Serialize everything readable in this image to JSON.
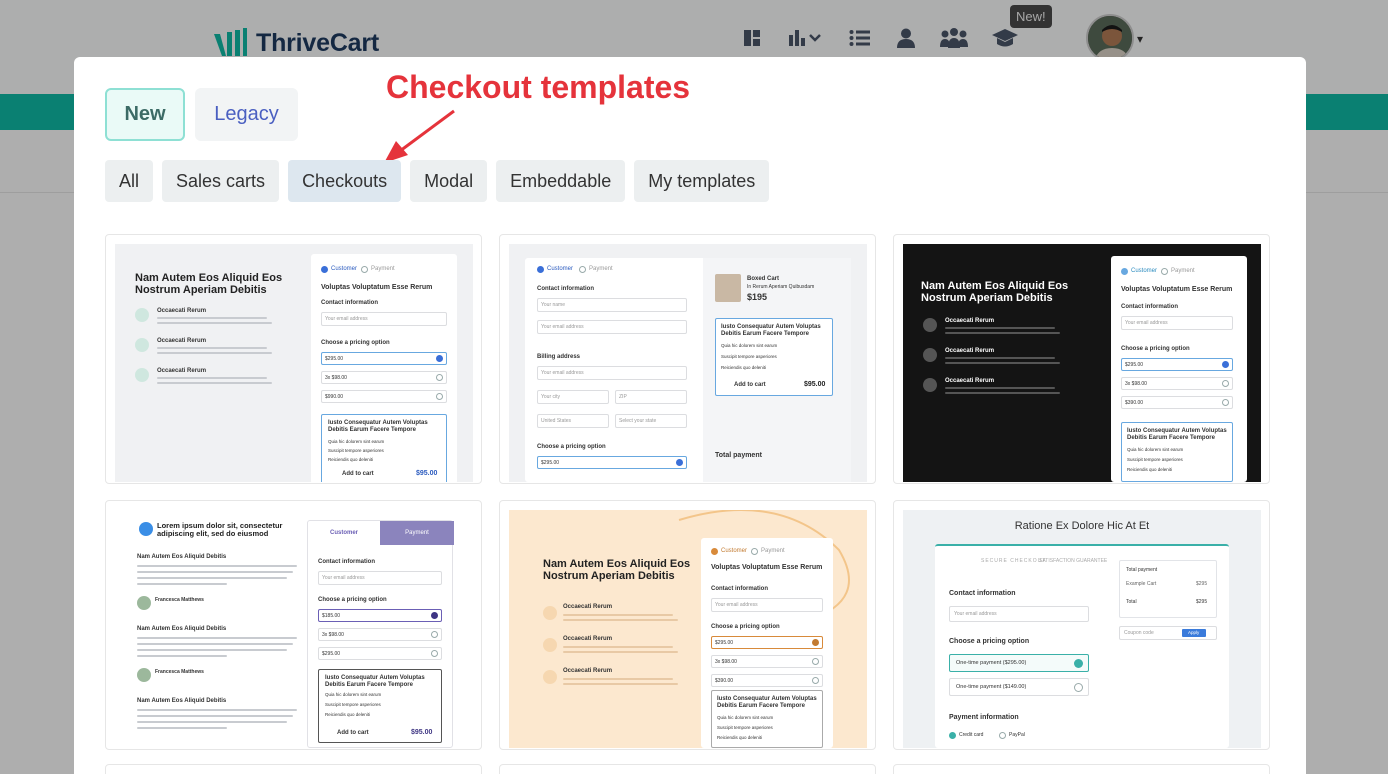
{
  "app": {
    "brand": "ThriveCart",
    "new_badge": "New!",
    "nav_icons": [
      "dashboard-icon",
      "analytics-icon",
      "list-icon",
      "user-icon",
      "team-icon",
      "graduation-cap-icon"
    ]
  },
  "modal": {
    "annotation": "Checkout templates",
    "toggle": {
      "new_label": "New",
      "legacy_label": "Legacy"
    },
    "filters": [
      {
        "label": "All"
      },
      {
        "label": "Sales carts"
      },
      {
        "label": "Checkouts"
      },
      {
        "label": "Modal"
      },
      {
        "label": "Embeddable"
      },
      {
        "label": "My templates"
      }
    ],
    "active_filter": "Checkouts"
  },
  "templates": [
    {
      "heading": "Nam Autem Eos Aliquid Eos Nostrum Aperiam Debitis",
      "steps": [
        "Customer",
        "Payment"
      ],
      "form_title": "Voluptas Voluptatum Esse Rerum",
      "contact": "Contact information",
      "email_placeholder": "Your email address",
      "pricing": "Choose a pricing option",
      "features": [
        "Occaecati Rerum",
        "Occaecati Rerum",
        "Occaecati Rerum"
      ],
      "bump_title": "Iusto Consequatur Autem Voluptas Debitis Earum Facere Tempore",
      "bump_items": [
        "Quia hic dolorem sint earum",
        "Suscipit tempore asperiores",
        "Reiciendis quo deleniti"
      ],
      "add_to_cart": "Add to cart",
      "price": "$95.00",
      "options": [
        "$295.00",
        "3x $98.00",
        "$990.00"
      ]
    },
    {
      "steps": [
        "Customer",
        "Payment"
      ],
      "contact": "Contact information",
      "name_placeholder": "Your name",
      "email_placeholder": "Your email address",
      "billing": "Billing address",
      "pricing": "Choose a pricing option",
      "product_title": "Boxed Cart",
      "product_sub": "In Rerum Aperiam Quibusdam",
      "product_price": "$195",
      "bump_title": "Iusto Consequatur Autem Voluptas Debitis Earum Facere Tempore",
      "bump_items": [
        "Quia hic dolorem sint earum",
        "Suscipit tempore asperiores",
        "Reiciendis quo deleniti"
      ],
      "add_to_cart": "Add to cart",
      "price": "$95.00",
      "total": "Total payment",
      "country": "United States",
      "state": "Select your state",
      "city": "Your city",
      "zip": "ZIP",
      "option": "$295.00"
    },
    {
      "heading": "Nam Autem Eos Aliquid Eos Nostrum Aperiam Debitis",
      "steps": [
        "Customer",
        "Payment"
      ],
      "form_title": "Voluptas Voluptatum Esse Rerum",
      "contact": "Contact information",
      "email_placeholder": "Your email address",
      "pricing": "Choose a pricing option",
      "features": [
        "Occaecati Rerum",
        "Occaecati Rerum",
        "Occaecati Rerum"
      ],
      "bump_title": "Iusto Consequatur Autem Voluptas Debitis Earum Facere Tempore",
      "bump_items": [
        "Quia hic dolorem sint earum",
        "Suscipit tempore asperiores",
        "Reiciendis quo deleniti"
      ],
      "options": [
        "$295.00",
        "3x $98.00",
        "$390.00"
      ]
    },
    {
      "heading": "Lorem ipsum dolor sit, consectetur adipiscing elit, sed do eiusmod",
      "tabs": [
        "Customer",
        "Payment"
      ],
      "contact": "Contact information",
      "email_placeholder": "Your email address",
      "pricing": "Choose a pricing option",
      "testimonials": [
        "Nam Autem Eos Aliquid Debitis",
        "Nam Autem Eos Aliquid Debitis",
        "Nam Autem Eos Aliquid Debitis"
      ],
      "author": "Francesca Matthews",
      "bump_title": "Iusto Consequatur Autem Voluptas Debitis Earum Facere Tempore",
      "bump_items": [
        "Quia hic dolorem sint earum",
        "Suscipit tempore asperiores",
        "Reiciendis quo deleniti"
      ],
      "add_to_cart": "Add to cart",
      "price": "$95.00",
      "options": [
        "$185.00",
        "3x $98.00",
        "$295.00"
      ]
    },
    {
      "heading": "Nam Autem Eos Aliquid Eos Nostrum Aperiam Debitis",
      "steps": [
        "Customer",
        "Payment"
      ],
      "form_title": "Voluptas Voluptatum Esse Rerum",
      "contact": "Contact information",
      "email_placeholder": "Your email address",
      "pricing": "Choose a pricing option",
      "features": [
        "Occaecati Rerum",
        "Occaecati Rerum",
        "Occaecati Rerum"
      ],
      "bump_title": "Iusto Consequatur Autem Voluptas Debitis Earum Facere Tempore",
      "bump_items": [
        "Quia hic dolorem sint earum",
        "Suscipit tempore asperiores",
        "Reiciendis quo deleniti"
      ],
      "options": [
        "$295.00",
        "3x $98.00",
        "$390.00"
      ]
    },
    {
      "heading": "Ratione Ex Dolore Hic At Et",
      "secure": "SECURE CHECKOUT",
      "guarantee": "SATISFACTION GUARANTEE",
      "contact": "Contact information",
      "email_placeholder": "Your email address",
      "pricing": "Choose a pricing option",
      "option1": "One-time payment ($295.00)",
      "option2": "One-time payment ($149.00)",
      "payment": "Payment information",
      "credit": "Credit card",
      "paypal": "PayPal",
      "total": "Total payment",
      "cart_name": "Example Cart",
      "cart_price": "$295",
      "total_label": "Total",
      "total_price": "$295",
      "coupon": "Coupon code",
      "apply": "Apply"
    }
  ],
  "colors": {
    "teal": "#0fb8a4",
    "annotation_red": "#e5333b",
    "legacy_blue": "#4a5fc1"
  }
}
